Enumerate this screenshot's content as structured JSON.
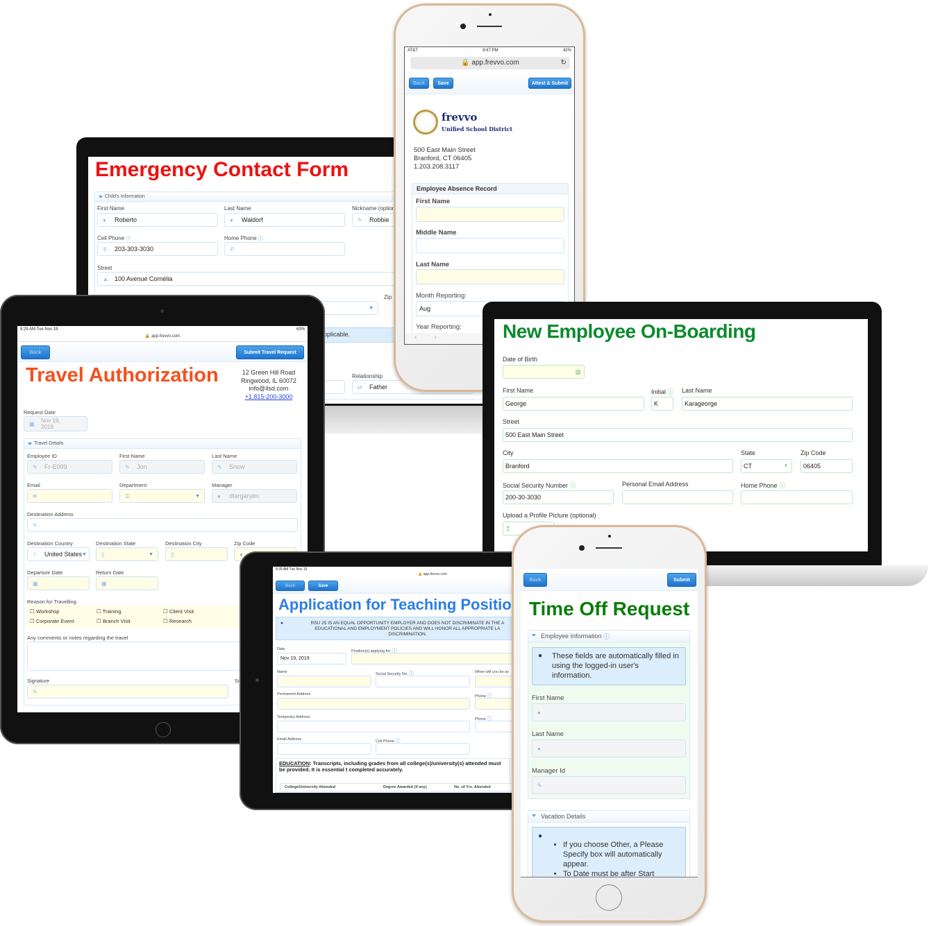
{
  "emergency": {
    "title": "Emergency Contact Form",
    "title_color": "#ee1111",
    "section": "Child's Information",
    "first_name": {
      "label": "First Name",
      "value": "Roberto"
    },
    "last_name": {
      "label": "Last Name",
      "value": "Waldorf"
    },
    "nickname": {
      "label": "Nickname (option",
      "value": "Robbie"
    },
    "cell_phone": {
      "label": "Cell Phone",
      "value": "203-303-3030"
    },
    "home_phone": {
      "label": "Home Phone",
      "value": ""
    },
    "street": {
      "label": "Street",
      "value": "100 Avenue Cornélia"
    },
    "zip_label": "Zip",
    "info_fragment": "pplicable.",
    "relationship": {
      "label": "Relationship",
      "value": "Father"
    }
  },
  "absence_phone": {
    "carrier": "AT&T",
    "time": "9:47 PM",
    "battery": "42%",
    "url": "app.frevvo.com",
    "buttons": {
      "back": "Back",
      "save": "Save",
      "submit": "Attest & Submit"
    },
    "logo_name": "frevvo",
    "logo_sub": "Unified School District",
    "address": [
      "500 East Main Street",
      "Branford, CT 06405",
      "1.203.208.3117"
    ],
    "section": "Employee Absence Record",
    "first_name": "First Name",
    "middle_name": "Middle Name",
    "last_name": "Last Name",
    "month_label": "Month Reporting:",
    "month_value": "Aug",
    "year_label": "Year Reporting:"
  },
  "onboarding": {
    "title": "New Employee On-Boarding",
    "title_color": "#0b8a2e",
    "dob": "Date of Birth",
    "first_name": {
      "label": "First Name",
      "value": "George"
    },
    "initial": {
      "label": "Initial",
      "value": "K"
    },
    "last_name": {
      "label": "Last Name",
      "value": "Karageorge"
    },
    "street": {
      "label": "Street",
      "value": "500 East Main Street"
    },
    "city": {
      "label": "City",
      "value": "Branford"
    },
    "state": {
      "label": "State",
      "value": "CT"
    },
    "zip": {
      "label": "Zip Code",
      "value": "06405"
    },
    "ssn": {
      "label": "Social Security Number",
      "value": "200-30-3030"
    },
    "email": {
      "label": "Personal Email Address",
      "value": ""
    },
    "home_phone": {
      "label": "Home Phone",
      "value": ""
    },
    "upload": "Upload a Profile Picture (optional)"
  },
  "travel": {
    "status_time": "8:29 AM   Tue Nov 19",
    "battery": "63%",
    "url": "app.frevvo.com",
    "buttons": {
      "back": "Back",
      "submit": "Submit Travel Request"
    },
    "title": "Travel Authorization",
    "title_color": "#f4511e",
    "address": [
      "12 Green Hill Road",
      "Ringwood, IL 60072",
      "info@ilsd.com"
    ],
    "phone_link": "+1.815-200-3000",
    "request_date": {
      "label": "Request Date",
      "value": "Nov 19, 2019"
    },
    "section": "Travel Details",
    "employee_id": {
      "label": "Employee ID",
      "value": "Fr-E009"
    },
    "first_name": {
      "label": "First Name",
      "value": "Jon"
    },
    "last_name": {
      "label": "Last Name",
      "value": "Snow"
    },
    "email": "Email",
    "department": "Department",
    "manager": {
      "label": "Manager",
      "value": "dtargaryen"
    },
    "dest_address": "Destination Address",
    "dest_country": {
      "label": "Destination Country",
      "value": "United States"
    },
    "dest_state": "Destination State",
    "dest_city": "Destination City",
    "zip": "Zip Code",
    "departure": "Departure Date",
    "return": "Return Date",
    "reason": "Reason for Travelling",
    "reasons": [
      "Workshop",
      "Training",
      "Client Visit",
      "Corporate Event",
      "Branch Visit",
      "Research"
    ],
    "comments": "Any comments or notes regarding the travel",
    "signature": "Signature",
    "sig_fragment": "Si"
  },
  "teaching": {
    "status_time": "8:35 AM   Tue Nov 19",
    "url": "app.frevvo.com",
    "buttons": {
      "back": "Back",
      "save": "Save"
    },
    "title": "Application for Teaching Position",
    "title_color": "#2b7de9",
    "notice": "RSU 25 IS AN EQUAL OPPORTUNITY EMPLOYER AND DOES NOT DISCRIMINATE IN THE A EDUCATIONAL AND EMPLOYMENT POLICIES AND WILL HONOR ALL APPROPRIATE LA DISCRIMINATION.",
    "date": {
      "label": "Date",
      "value": "Nov 19, 2019"
    },
    "position": "Position(s) applying for:",
    "name": "Name",
    "ssn": "Social Security No.",
    "available": "When will you be av",
    "perm_address": "Permanent Address",
    "phone": "Phone",
    "temp_address": "Temporary Address",
    "email": "Email Address",
    "cell": "Cell Phone",
    "education_label": "EDUCATION",
    "education_text": ": Transcripts, including grades from all college(s)/university(s) attended must be provided. It is essential t completed accurately.",
    "table_headers": [
      "College/University Attended",
      "Degree Awarded (if any)",
      "No. of Yrs. Attended"
    ]
  },
  "timeoff": {
    "buttons": {
      "back": "Back",
      "submit": "Submit"
    },
    "title": "Time Off Request",
    "title_color": "#0a7d0a",
    "section1": "Employee Information",
    "info1": "These fields are automatically filled in using the logged-in user's information.",
    "first_name": "First Name",
    "last_name": "Last Name",
    "manager_id": "Manager Id",
    "section2": "Vacation Details",
    "bullets": [
      "If you choose Other, a Please Specify box will automatically appear.",
      "To Date must be after Start"
    ]
  }
}
